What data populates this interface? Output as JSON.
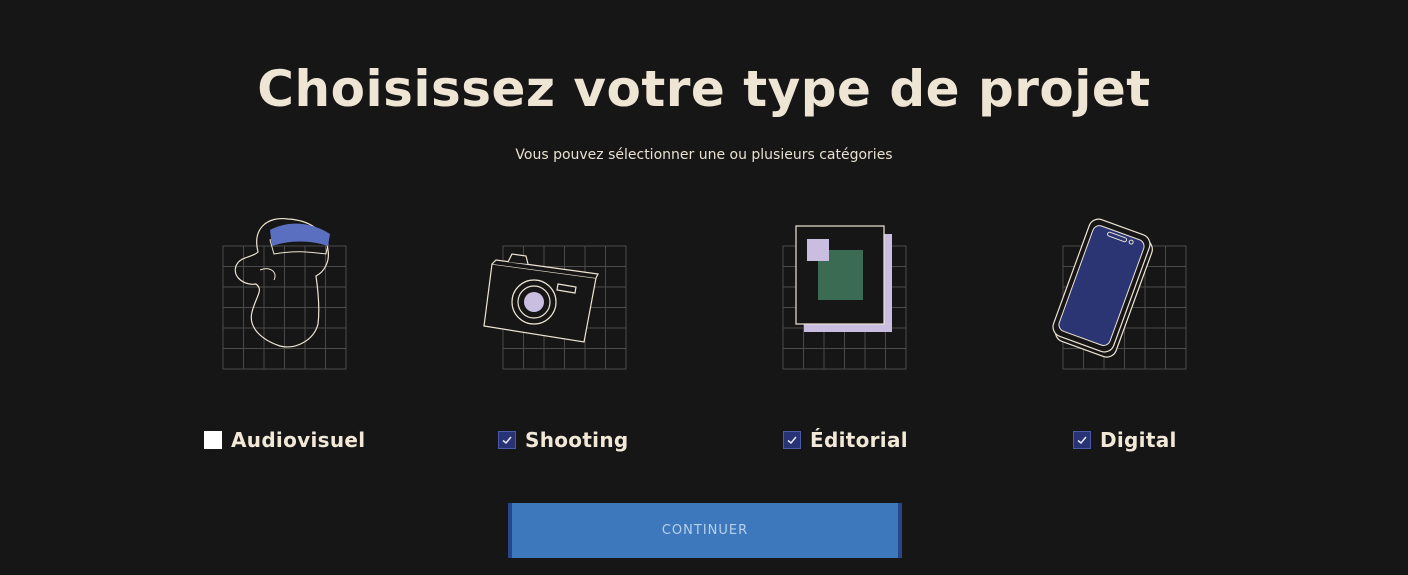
{
  "page": {
    "title": "Choisissez votre type de projet",
    "subtitle": "Vous pouvez sélectionner une ou plusieurs catégories"
  },
  "options": [
    {
      "label": "Audiovisuel",
      "checked": false,
      "icon": "statue-head-illustration"
    },
    {
      "label": "Shooting",
      "checked": true,
      "icon": "camera-illustration"
    },
    {
      "label": "Éditorial",
      "checked": true,
      "icon": "documents-illustration"
    },
    {
      "label": "Digital",
      "checked": true,
      "icon": "smartphone-illustration"
    }
  ],
  "button": {
    "label": "CONTINUER"
  },
  "colors": {
    "background": "#161616",
    "text": "#efe5d4",
    "grid": "#4a4a4a",
    "checkbox_checked": "#283375",
    "button": "#3d78bd",
    "accent_blue": "#5a6fc0",
    "accent_lavender": "#c9bde0",
    "accent_green": "#3b6b52",
    "phone_screen": "#2b3574"
  }
}
